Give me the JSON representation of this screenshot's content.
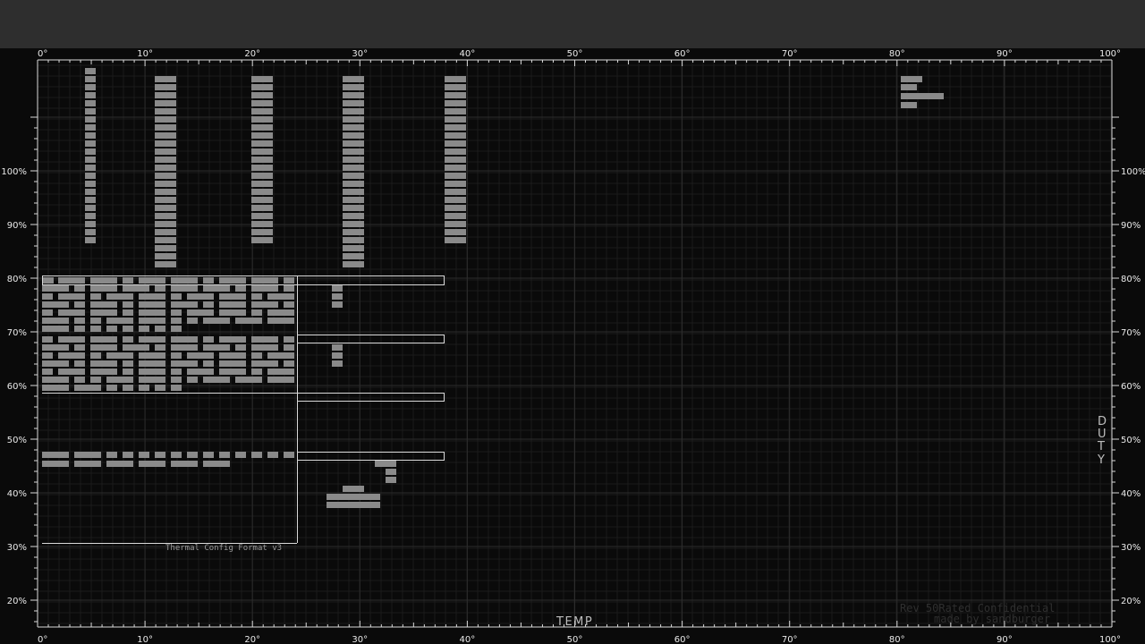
{
  "screen": {
    "top_bar_color": "#2e2e2e",
    "background": "#0a0a0a",
    "grid_minor_color": "#1b1b1b",
    "grid_major_color": "#2c2c2c",
    "axis_color": "#d9d9d9",
    "block_color": "#8a8a8a",
    "outline_color": "#d9d9d9"
  },
  "axes": {
    "x_title": "TEMP",
    "y_title": [
      "D",
      "U",
      "T",
      "Y"
    ],
    "x_ticks": [
      "0°",
      "10°",
      "20°",
      "30°",
      "40°",
      "50°",
      "60°",
      "70°",
      "80°",
      "90°",
      "100°"
    ],
    "y_ticks": [
      "100%",
      "90%",
      "80%",
      "70%",
      "60%",
      "50%",
      "40%",
      "30%",
      "20%"
    ]
  },
  "caption": "Thermal Config Format v3",
  "watermark": [
    "Rev 50Rated Confidential",
    "made by sandburger"
  ]
}
